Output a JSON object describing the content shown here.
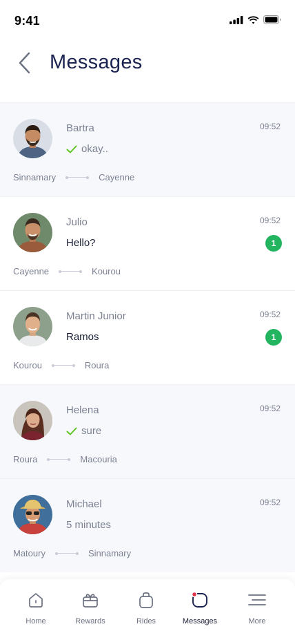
{
  "status_bar": {
    "time": "9:41"
  },
  "header": {
    "title": "Messages"
  },
  "colors": {
    "accent": "#1b2350",
    "badge": "#22b45e",
    "check": "#5ec423",
    "active_dot": "#e0344a"
  },
  "messages": [
    {
      "name": "Bartra",
      "time": "09:52",
      "preview": "okay..",
      "read_check": true,
      "unread": null,
      "from": "Sinnamary",
      "to": "Cayenne"
    },
    {
      "name": "Julio",
      "time": "09:52",
      "preview": "Hello?",
      "read_check": false,
      "unread": "1",
      "from": "Cayenne",
      "to": "Kourou"
    },
    {
      "name": "Martin Junior",
      "time": "09:52",
      "preview": "Ramos",
      "read_check": false,
      "unread": "1",
      "from": "Kourou",
      "to": "Roura"
    },
    {
      "name": "Helena",
      "time": "09:52",
      "preview": "sure",
      "read_check": true,
      "unread": null,
      "from": "Roura",
      "to": "Macouria"
    },
    {
      "name": "Michael",
      "time": "09:52",
      "preview": "5 minutes",
      "read_check": false,
      "unread": null,
      "from": "Matoury",
      "to": "Sinnamary"
    }
  ],
  "tabbar": {
    "items": [
      {
        "label": "Home",
        "icon": "home-icon"
      },
      {
        "label": "Rewards",
        "icon": "gift-icon"
      },
      {
        "label": "Rides",
        "icon": "bag-icon"
      },
      {
        "label": "Messages",
        "icon": "chat-icon"
      },
      {
        "label": "More",
        "icon": "menu-icon"
      }
    ],
    "active": "Messages"
  }
}
